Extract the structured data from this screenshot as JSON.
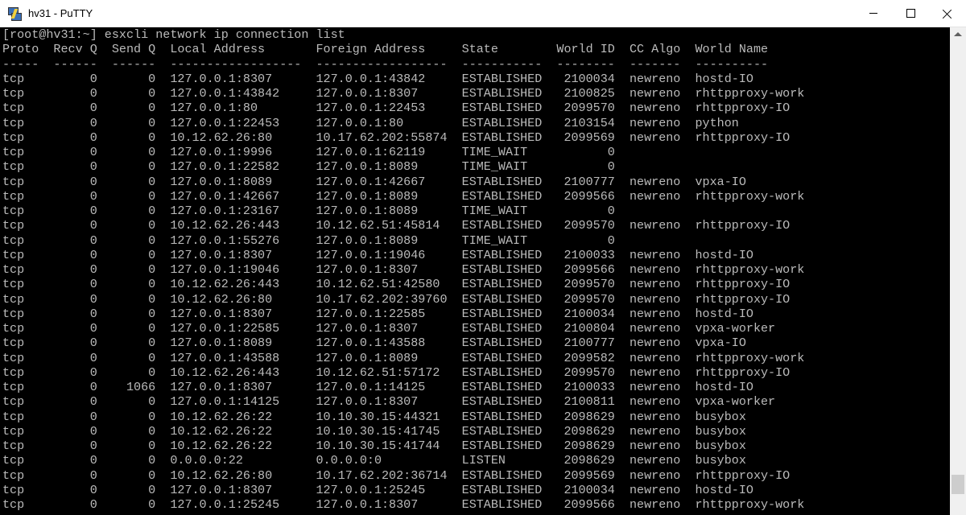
{
  "window": {
    "title": "hv31 - PuTTY",
    "icon": "putty-icon",
    "controls": [
      "minimize-icon",
      "maximize-icon",
      "close-icon"
    ]
  },
  "terminal": {
    "prompt_line": "[root@hv31:~] esxcli network ip connection list",
    "header": "Proto  Recv Q  Send Q  Local Address       Foreign Address     State        World ID  CC Algo  World Name",
    "separator": "-----  ------  ------  ------------------  ------------------  -----------  --------  -------  ----------",
    "columns": [
      "Proto",
      "Recv Q",
      "Send Q",
      "Local Address",
      "Foreign Address",
      "State",
      "World ID",
      "CC Algo",
      "World Name"
    ],
    "rows": [
      [
        "tcp",
        "0",
        "0",
        "127.0.0.1:8307",
        "127.0.0.1:43842",
        "ESTABLISHED",
        "2100034",
        "newreno",
        "hostd-IO"
      ],
      [
        "tcp",
        "0",
        "0",
        "127.0.0.1:43842",
        "127.0.0.1:8307",
        "ESTABLISHED",
        "2100825",
        "newreno",
        "rhttpproxy-work"
      ],
      [
        "tcp",
        "0",
        "0",
        "127.0.0.1:80",
        "127.0.0.1:22453",
        "ESTABLISHED",
        "2099570",
        "newreno",
        "rhttpproxy-IO"
      ],
      [
        "tcp",
        "0",
        "0",
        "127.0.0.1:22453",
        "127.0.0.1:80",
        "ESTABLISHED",
        "2103154",
        "newreno",
        "python"
      ],
      [
        "tcp",
        "0",
        "0",
        "10.12.62.26:80",
        "10.17.62.202:55874",
        "ESTABLISHED",
        "2099569",
        "newreno",
        "rhttpproxy-IO"
      ],
      [
        "tcp",
        "0",
        "0",
        "127.0.0.1:9996",
        "127.0.0.1:62119",
        "TIME_WAIT",
        "0",
        "",
        ""
      ],
      [
        "tcp",
        "0",
        "0",
        "127.0.0.1:22582",
        "127.0.0.1:8089",
        "TIME_WAIT",
        "0",
        "",
        ""
      ],
      [
        "tcp",
        "0",
        "0",
        "127.0.0.1:8089",
        "127.0.0.1:42667",
        "ESTABLISHED",
        "2100777",
        "newreno",
        "vpxa-IO"
      ],
      [
        "tcp",
        "0",
        "0",
        "127.0.0.1:42667",
        "127.0.0.1:8089",
        "ESTABLISHED",
        "2099566",
        "newreno",
        "rhttpproxy-work"
      ],
      [
        "tcp",
        "0",
        "0",
        "127.0.0.1:23167",
        "127.0.0.1:8089",
        "TIME_WAIT",
        "0",
        "",
        ""
      ],
      [
        "tcp",
        "0",
        "0",
        "10.12.62.26:443",
        "10.12.62.51:45814",
        "ESTABLISHED",
        "2099570",
        "newreno",
        "rhttpproxy-IO"
      ],
      [
        "tcp",
        "0",
        "0",
        "127.0.0.1:55276",
        "127.0.0.1:8089",
        "TIME_WAIT",
        "0",
        "",
        ""
      ],
      [
        "tcp",
        "0",
        "0",
        "127.0.0.1:8307",
        "127.0.0.1:19046",
        "ESTABLISHED",
        "2100033",
        "newreno",
        "hostd-IO"
      ],
      [
        "tcp",
        "0",
        "0",
        "127.0.0.1:19046",
        "127.0.0.1:8307",
        "ESTABLISHED",
        "2099566",
        "newreno",
        "rhttpproxy-work"
      ],
      [
        "tcp",
        "0",
        "0",
        "10.12.62.26:443",
        "10.12.62.51:42580",
        "ESTABLISHED",
        "2099570",
        "newreno",
        "rhttpproxy-IO"
      ],
      [
        "tcp",
        "0",
        "0",
        "10.12.62.26:80",
        "10.17.62.202:39760",
        "ESTABLISHED",
        "2099570",
        "newreno",
        "rhttpproxy-IO"
      ],
      [
        "tcp",
        "0",
        "0",
        "127.0.0.1:8307",
        "127.0.0.1:22585",
        "ESTABLISHED",
        "2100034",
        "newreno",
        "hostd-IO"
      ],
      [
        "tcp",
        "0",
        "0",
        "127.0.0.1:22585",
        "127.0.0.1:8307",
        "ESTABLISHED",
        "2100804",
        "newreno",
        "vpxa-worker"
      ],
      [
        "tcp",
        "0",
        "0",
        "127.0.0.1:8089",
        "127.0.0.1:43588",
        "ESTABLISHED",
        "2100777",
        "newreno",
        "vpxa-IO"
      ],
      [
        "tcp",
        "0",
        "0",
        "127.0.0.1:43588",
        "127.0.0.1:8089",
        "ESTABLISHED",
        "2099582",
        "newreno",
        "rhttpproxy-work"
      ],
      [
        "tcp",
        "0",
        "0",
        "10.12.62.26:443",
        "10.12.62.51:57172",
        "ESTABLISHED",
        "2099570",
        "newreno",
        "rhttpproxy-IO"
      ],
      [
        "tcp",
        "0",
        "1066",
        "127.0.0.1:8307",
        "127.0.0.1:14125",
        "ESTABLISHED",
        "2100033",
        "newreno",
        "hostd-IO"
      ],
      [
        "tcp",
        "0",
        "0",
        "127.0.0.1:14125",
        "127.0.0.1:8307",
        "ESTABLISHED",
        "2100811",
        "newreno",
        "vpxa-worker"
      ],
      [
        "tcp",
        "0",
        "0",
        "10.12.62.26:22",
        "10.10.30.15:44321",
        "ESTABLISHED",
        "2098629",
        "newreno",
        "busybox"
      ],
      [
        "tcp",
        "0",
        "0",
        "10.12.62.26:22",
        "10.10.30.15:41745",
        "ESTABLISHED",
        "2098629",
        "newreno",
        "busybox"
      ],
      [
        "tcp",
        "0",
        "0",
        "10.12.62.26:22",
        "10.10.30.15:41744",
        "ESTABLISHED",
        "2098629",
        "newreno",
        "busybox"
      ],
      [
        "tcp",
        "0",
        "0",
        "0.0.0.0:22",
        "0.0.0.0:0",
        "LISTEN",
        "2098629",
        "newreno",
        "busybox"
      ],
      [
        "tcp",
        "0",
        "0",
        "10.12.62.26:80",
        "10.17.62.202:36714",
        "ESTABLISHED",
        "2099569",
        "newreno",
        "rhttpproxy-IO"
      ],
      [
        "tcp",
        "0",
        "0",
        "127.0.0.1:8307",
        "127.0.0.1:25245",
        "ESTABLISHED",
        "2100034",
        "newreno",
        "hostd-IO"
      ],
      [
        "tcp",
        "0",
        "0",
        "127.0.0.1:25245",
        "127.0.0.1:8307",
        "ESTABLISHED",
        "2099566",
        "newreno",
        "rhttpproxy-work"
      ]
    ]
  },
  "colors": {
    "terminal_bg": "#000000",
    "terminal_fg": "#bbbbbb",
    "titlebar_bg": "#ffffff"
  }
}
